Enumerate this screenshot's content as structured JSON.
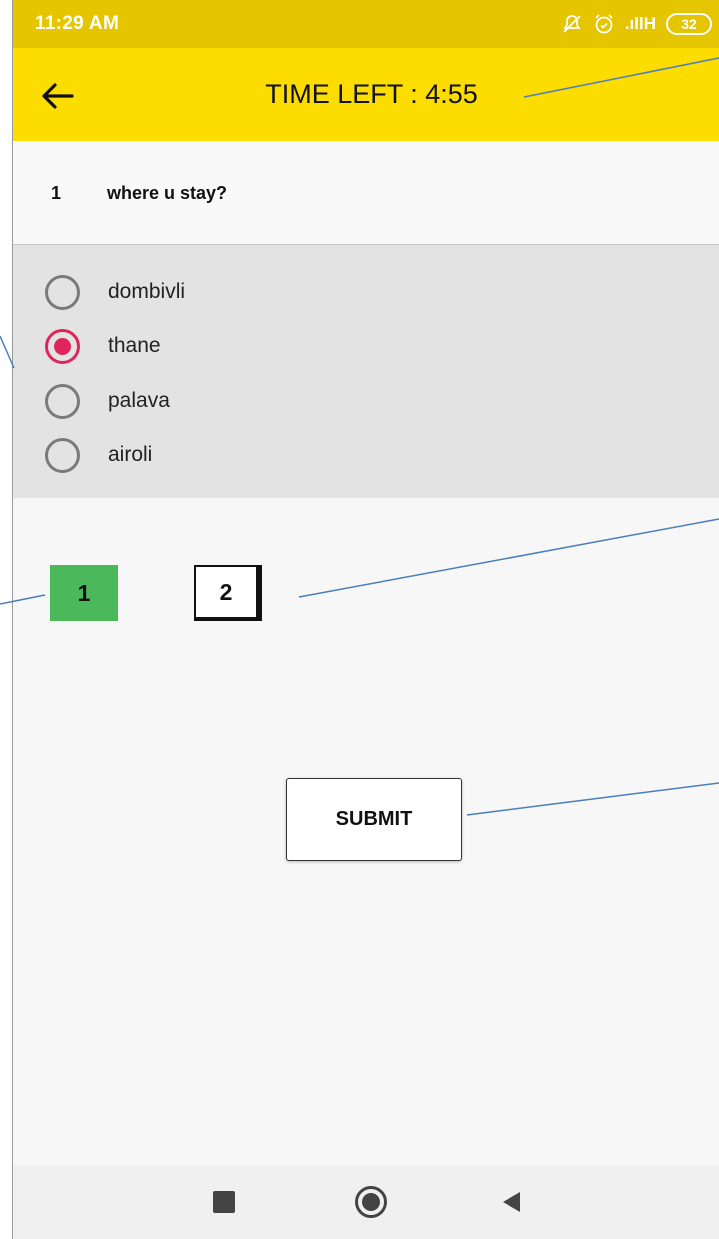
{
  "status_bar": {
    "time": "11:29 AM",
    "network": ".ıllH",
    "battery": "32",
    "icons": [
      "mute-icon",
      "alarm-icon",
      "signal-icon"
    ]
  },
  "app_bar": {
    "back_icon": "arrow-left-icon",
    "timer_text": "TIME LEFT : 4:55"
  },
  "question": {
    "number": "1",
    "text": "where u stay?"
  },
  "options": [
    {
      "label": "dombivli",
      "selected": false
    },
    {
      "label": "thane",
      "selected": true
    },
    {
      "label": "palava",
      "selected": false
    },
    {
      "label": "airoli",
      "selected": false
    }
  ],
  "question_nav": [
    {
      "label": "1",
      "state": "answered",
      "color": "#4cb85c"
    },
    {
      "label": "2",
      "state": "current"
    }
  ],
  "submit_label": "SUBMIT",
  "colors": {
    "status_bar": "#e5c400",
    "app_bar": "#fddc00",
    "accent": "#e0245e",
    "answered": "#4cb85c",
    "callout": "#4a7ebb"
  },
  "system_nav": [
    "recents-icon",
    "home-icon",
    "back-icon"
  ]
}
